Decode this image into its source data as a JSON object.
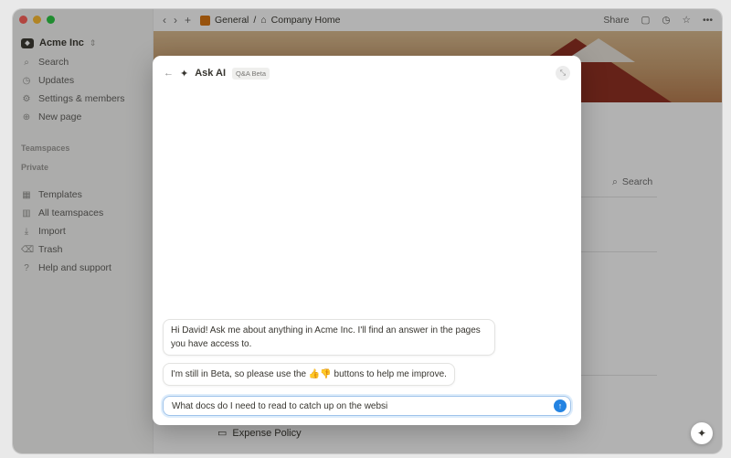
{
  "sidebar": {
    "workspace": "Acme Inc",
    "items_top": [
      {
        "icon": "search-icon",
        "glyph": "⌕",
        "label": "Search"
      },
      {
        "icon": "clock-icon",
        "glyph": "◷",
        "label": "Updates"
      },
      {
        "icon": "gear-icon",
        "glyph": "⚙",
        "label": "Settings & members"
      },
      {
        "icon": "plus-circle-icon",
        "glyph": "⊕",
        "label": "New page"
      }
    ],
    "section_teamspaces": "Teamspaces",
    "section_private": "Private",
    "items_bottom": [
      {
        "icon": "template-icon",
        "glyph": "▦",
        "label": "Templates"
      },
      {
        "icon": "building-icon",
        "glyph": "▥",
        "label": "All teamspaces"
      },
      {
        "icon": "import-icon",
        "glyph": "⤓",
        "label": "Import"
      },
      {
        "icon": "trash-icon",
        "glyph": "🗑",
        "label": "Trash"
      },
      {
        "icon": "help-icon",
        "glyph": "?",
        "label": "Help and support"
      }
    ]
  },
  "topbar": {
    "crumb_1": "General",
    "crumb_sep": "/",
    "crumb_2": "Company Home",
    "share": "Share"
  },
  "page": {
    "search_label": "Search",
    "expense_label": "Expense Policy"
  },
  "modal": {
    "title": "Ask AI",
    "badge": "Q&A Beta",
    "messages": [
      "Hi David! Ask me about anything in Acme Inc. I'll find an answer in the pages you have access to.",
      "I'm still in Beta, so please use the 👍👎 buttons to help me improve."
    ],
    "input_value": "What docs do I need to read to catch up on the websi"
  },
  "colors": {
    "accent": "#2383e2",
    "close": "#ff5f57",
    "minimize": "#febc2e",
    "zoom": "#28c840"
  }
}
